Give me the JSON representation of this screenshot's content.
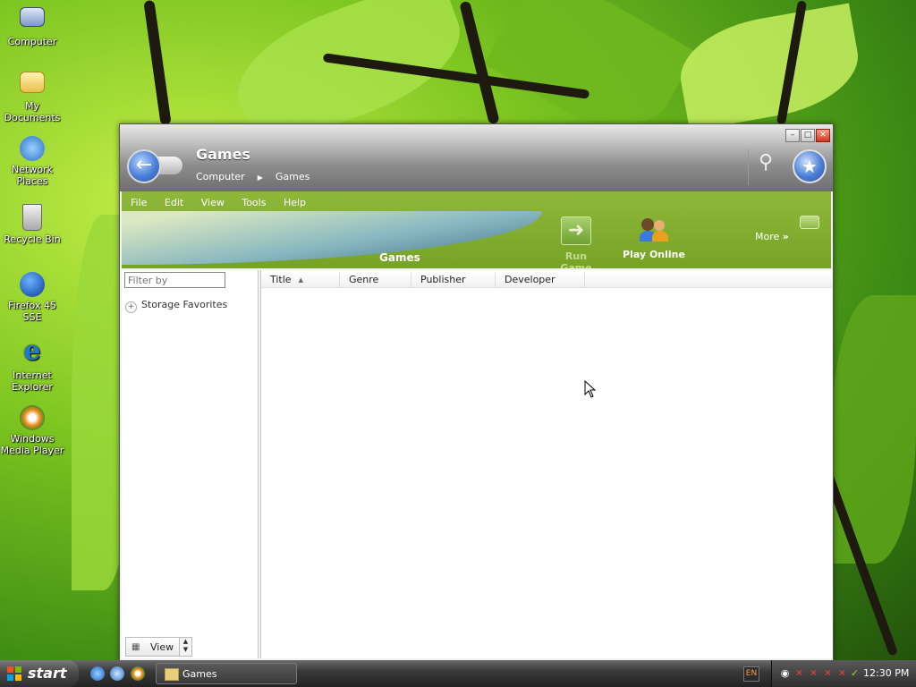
{
  "desktop": {
    "icons": [
      {
        "label": "Computer"
      },
      {
        "label": "My Documents"
      },
      {
        "label": "Network Places"
      },
      {
        "label": "Recycle Bin"
      },
      {
        "label": "Firefox 45 SSE"
      },
      {
        "label": "Internet Explorer"
      },
      {
        "label": "Windows Media Player"
      }
    ]
  },
  "window": {
    "title": "Games",
    "breadcrumb": [
      "Computer",
      "Games"
    ],
    "menu": [
      "File",
      "Edit",
      "View",
      "Tools",
      "Help"
    ],
    "banner_title": "Games",
    "tasks": {
      "run_game": "Run Game",
      "play_online": "Play Online",
      "more": "More"
    },
    "left_pane": {
      "filter_placeholder": "Filter by",
      "tree_item": "Storage Favorites",
      "view_label": "View"
    },
    "columns": [
      "Title",
      "Genre",
      "Publisher",
      "Developer"
    ],
    "rows": []
  },
  "taskbar": {
    "start_label": "start",
    "task_button": "Games",
    "language": "EN",
    "clock": "12:30 PM"
  },
  "colors": {
    "banner_green": "#7faa2e",
    "accent_blue": "#4a7fd6",
    "taskbar_dark": "#2e2e2e"
  }
}
